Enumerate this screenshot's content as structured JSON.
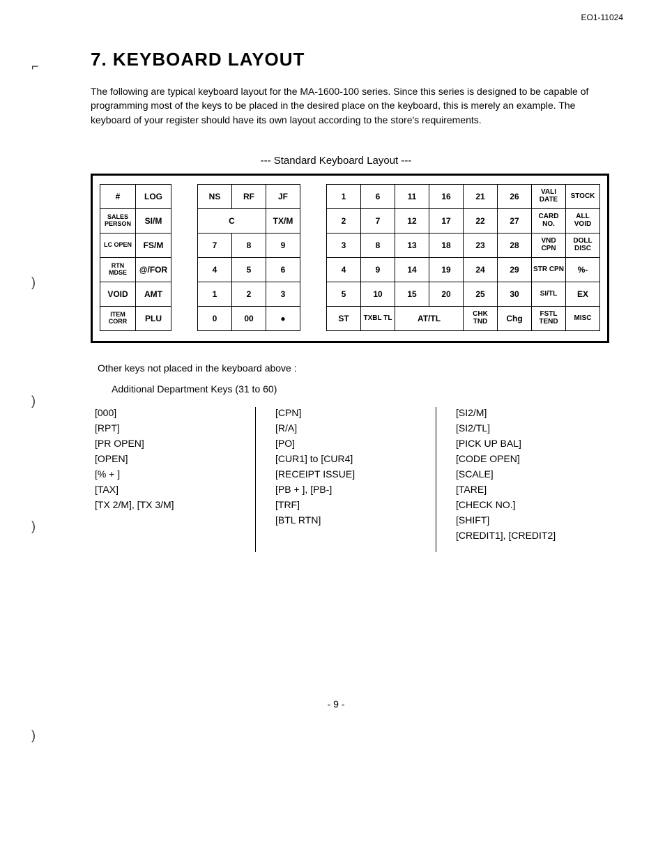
{
  "docId": "EO1-11024",
  "heading": "7.   KEYBOARD LAYOUT",
  "intro": "The following are typical keyboard layout for the MA-1600-100 series.   Since this series is designed to be capable of programming most of the keys to be placed in the desired place on the keyboard, this is merely an example.   The keyboard of your register should have its own layout according to the store's requirements.",
  "kbdCaption": "---    Standard Keyboard Layout    ---",
  "block1": [
    [
      "#",
      "LOG"
    ],
    [
      "SALES PERSON",
      "SI/M"
    ],
    [
      "LC OPEN",
      "FS/M"
    ],
    [
      "RTN MDSE",
      "@/FOR"
    ],
    [
      "VOID",
      "AMT"
    ],
    [
      "ITEM CORR",
      "PLU"
    ]
  ],
  "block2": [
    [
      "NS",
      "RF",
      "JF"
    ],
    [
      "C",
      "",
      "TX/M"
    ],
    [
      "7",
      "8",
      "9"
    ],
    [
      "4",
      "5",
      "6"
    ],
    [
      "1",
      "2",
      "3"
    ],
    [
      "0",
      "00",
      "●"
    ]
  ],
  "block3": [
    [
      "1",
      "6",
      "11",
      "16",
      "21",
      "26",
      "VALI DATE",
      "STOCK"
    ],
    [
      "2",
      "7",
      "12",
      "17",
      "22",
      "27",
      "CARD NO.",
      "ALL VOID"
    ],
    [
      "3",
      "8",
      "13",
      "18",
      "23",
      "28",
      "VND CPN",
      "DOLL DISC"
    ],
    [
      "4",
      "9",
      "14",
      "19",
      "24",
      "29",
      "STR CPN",
      "%-"
    ],
    [
      "5",
      "10",
      "15",
      "20",
      "25",
      "30",
      "SI/TL",
      "EX"
    ],
    [
      "ST",
      "TXBL TL",
      "AT/TL",
      "",
      "CHK TND",
      "Chg",
      "FSTL TEND",
      "MISC"
    ]
  ],
  "otherHeading": "Other keys not placed in the keyboard above :",
  "addDept": "Additional Department Keys (31 to 60)",
  "col1": [
    "[000]",
    "[RPT]",
    "[PR OPEN]",
    "[OPEN]",
    "[% + ]",
    "[TAX]",
    "[TX 2/M], [TX 3/M]"
  ],
  "col2": [
    "[CPN]",
    "[R/A]",
    "[PO]",
    "[CUR1] to [CUR4]",
    "[RECEIPT ISSUE]",
    "[PB + ], [PB-]",
    "[TRF]",
    "[BTL RTN]"
  ],
  "col3": [
    "[SI2/M]",
    "[SI2/TL]",
    "[PICK UP BAL]",
    "[CODE OPEN]",
    "[SCALE]",
    "[TARE]",
    "[CHECK NO.]",
    "[SHIFT]",
    "[CREDIT1], [CREDIT2]"
  ],
  "pageNum": "- 9 -"
}
